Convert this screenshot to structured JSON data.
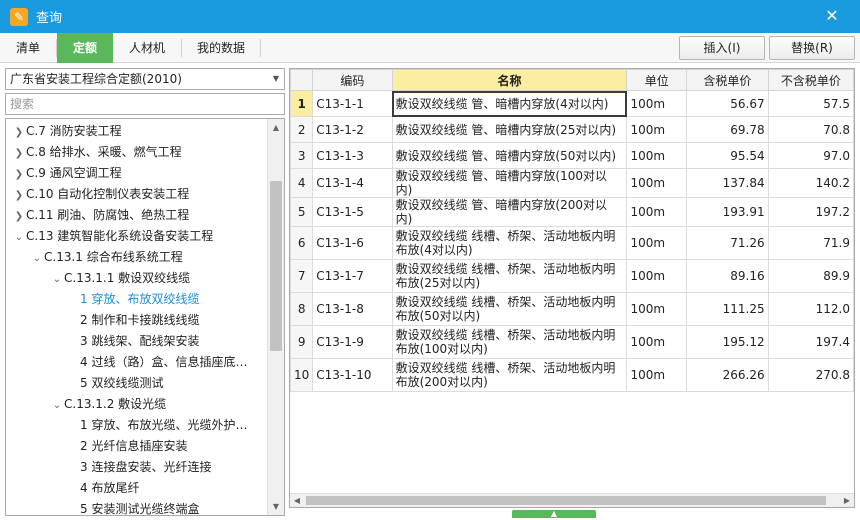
{
  "window": {
    "title": "查询",
    "icon_glyph": "✎",
    "close_glyph": "✕"
  },
  "tabs": [
    {
      "label": "清单",
      "active": false
    },
    {
      "label": "定额",
      "active": true
    },
    {
      "label": "人材机",
      "active": false
    },
    {
      "label": "我的数据",
      "active": false
    }
  ],
  "toolbar": {
    "insert_label": "插入(I)",
    "replace_label": "替换(R)"
  },
  "left": {
    "dropdown_value": "广东省安装工程综合定额(2010)",
    "search_placeholder": "搜索",
    "tree": [
      {
        "label": "C.7 消防安装工程",
        "level": 0,
        "toggle": "collapsed"
      },
      {
        "label": "C.8 给排水、采暖、燃气工程",
        "level": 0,
        "toggle": "collapsed"
      },
      {
        "label": "C.9 通风空调工程",
        "level": 0,
        "toggle": "collapsed"
      },
      {
        "label": "C.10 自动化控制仪表安装工程",
        "level": 0,
        "toggle": "collapsed"
      },
      {
        "label": "C.11 刷油、防腐蚀、绝热工程",
        "level": 0,
        "toggle": "collapsed"
      },
      {
        "label": "C.13 建筑智能化系统设备安装工程",
        "level": 0,
        "toggle": "expanded"
      },
      {
        "label": "C.13.1 综合布线系统工程",
        "level": 1,
        "toggle": "expanded"
      },
      {
        "label": "C.13.1.1 敷设双绞线缆",
        "level": 2,
        "toggle": "expanded"
      },
      {
        "label": "1 穿放、布放双绞线缆",
        "level": 3,
        "toggle": "none",
        "selected": true
      },
      {
        "label": "2 制作和卡接跳线线缆",
        "level": 3,
        "toggle": "none"
      },
      {
        "label": "3 跳线架、配线架安装",
        "level": 3,
        "toggle": "none"
      },
      {
        "label": "4 过线（路）盒、信息插座底…",
        "level": 3,
        "toggle": "none"
      },
      {
        "label": "5 双绞线缆测试",
        "level": 3,
        "toggle": "none"
      },
      {
        "label": "C.13.1.2 敷设光缆",
        "level": 2,
        "toggle": "expanded"
      },
      {
        "label": "1 穿放、布放光缆、光缆外护…",
        "level": 3,
        "toggle": "none"
      },
      {
        "label": "2 光纤信息插座安装",
        "level": 3,
        "toggle": "none"
      },
      {
        "label": "3 连接盘安装、光纤连接",
        "level": 3,
        "toggle": "none"
      },
      {
        "label": "4 布放尾纤",
        "level": 3,
        "toggle": "none"
      },
      {
        "label": "5 安装测试光缆终端盒",
        "level": 3,
        "toggle": "none"
      }
    ]
  },
  "grid": {
    "headers": [
      "编码",
      "名称",
      "单位",
      "含税单价",
      "不含税单价"
    ],
    "rows": [
      {
        "no": "1",
        "code": "C13-1-1",
        "name": "敷设双绞线缆 管、暗槽内穿放(4对以内)",
        "unit": "100m",
        "tax_price": "56.67",
        "notax_price": "57.5"
      },
      {
        "no": "2",
        "code": "C13-1-2",
        "name": "敷设双绞线缆 管、暗槽内穿放(25对以内)",
        "unit": "100m",
        "tax_price": "69.78",
        "notax_price": "70.8"
      },
      {
        "no": "3",
        "code": "C13-1-3",
        "name": "敷设双绞线缆 管、暗槽内穿放(50对以内)",
        "unit": "100m",
        "tax_price": "95.54",
        "notax_price": "97.0"
      },
      {
        "no": "4",
        "code": "C13-1-4",
        "name": "敷设双绞线缆 管、暗槽内穿放(100对以内)",
        "unit": "100m",
        "tax_price": "137.84",
        "notax_price": "140.2"
      },
      {
        "no": "5",
        "code": "C13-1-5",
        "name": "敷设双绞线缆 管、暗槽内穿放(200对以内)",
        "unit": "100m",
        "tax_price": "193.91",
        "notax_price": "197.2"
      },
      {
        "no": "6",
        "code": "C13-1-6",
        "name": "敷设双绞线缆 线槽、桥架、活动地板内明布放(4对以内)",
        "unit": "100m",
        "tax_price": "71.26",
        "notax_price": "71.9"
      },
      {
        "no": "7",
        "code": "C13-1-7",
        "name": "敷设双绞线缆 线槽、桥架、活动地板内明布放(25对以内)",
        "unit": "100m",
        "tax_price": "89.16",
        "notax_price": "89.9"
      },
      {
        "no": "8",
        "code": "C13-1-8",
        "name": "敷设双绞线缆 线槽、桥架、活动地板内明布放(50对以内)",
        "unit": "100m",
        "tax_price": "111.25",
        "notax_price": "112.0"
      },
      {
        "no": "9",
        "code": "C13-1-9",
        "name": "敷设双绞线缆 线槽、桥架、活动地板内明布放(100对以内)",
        "unit": "100m",
        "tax_price": "195.12",
        "notax_price": "197.4"
      },
      {
        "no": "10",
        "code": "C13-1-10",
        "name": "敷设双绞线缆 线槽、桥架、活动地板内明布放(200对以内)",
        "unit": "100m",
        "tax_price": "266.26",
        "notax_price": "270.8"
      }
    ]
  },
  "colors": {
    "titlebar": "#1a9be0",
    "active_tab": "#5ab85a",
    "header_highlight": "#fbeea0",
    "selected_tree": "#1a8fd6"
  }
}
